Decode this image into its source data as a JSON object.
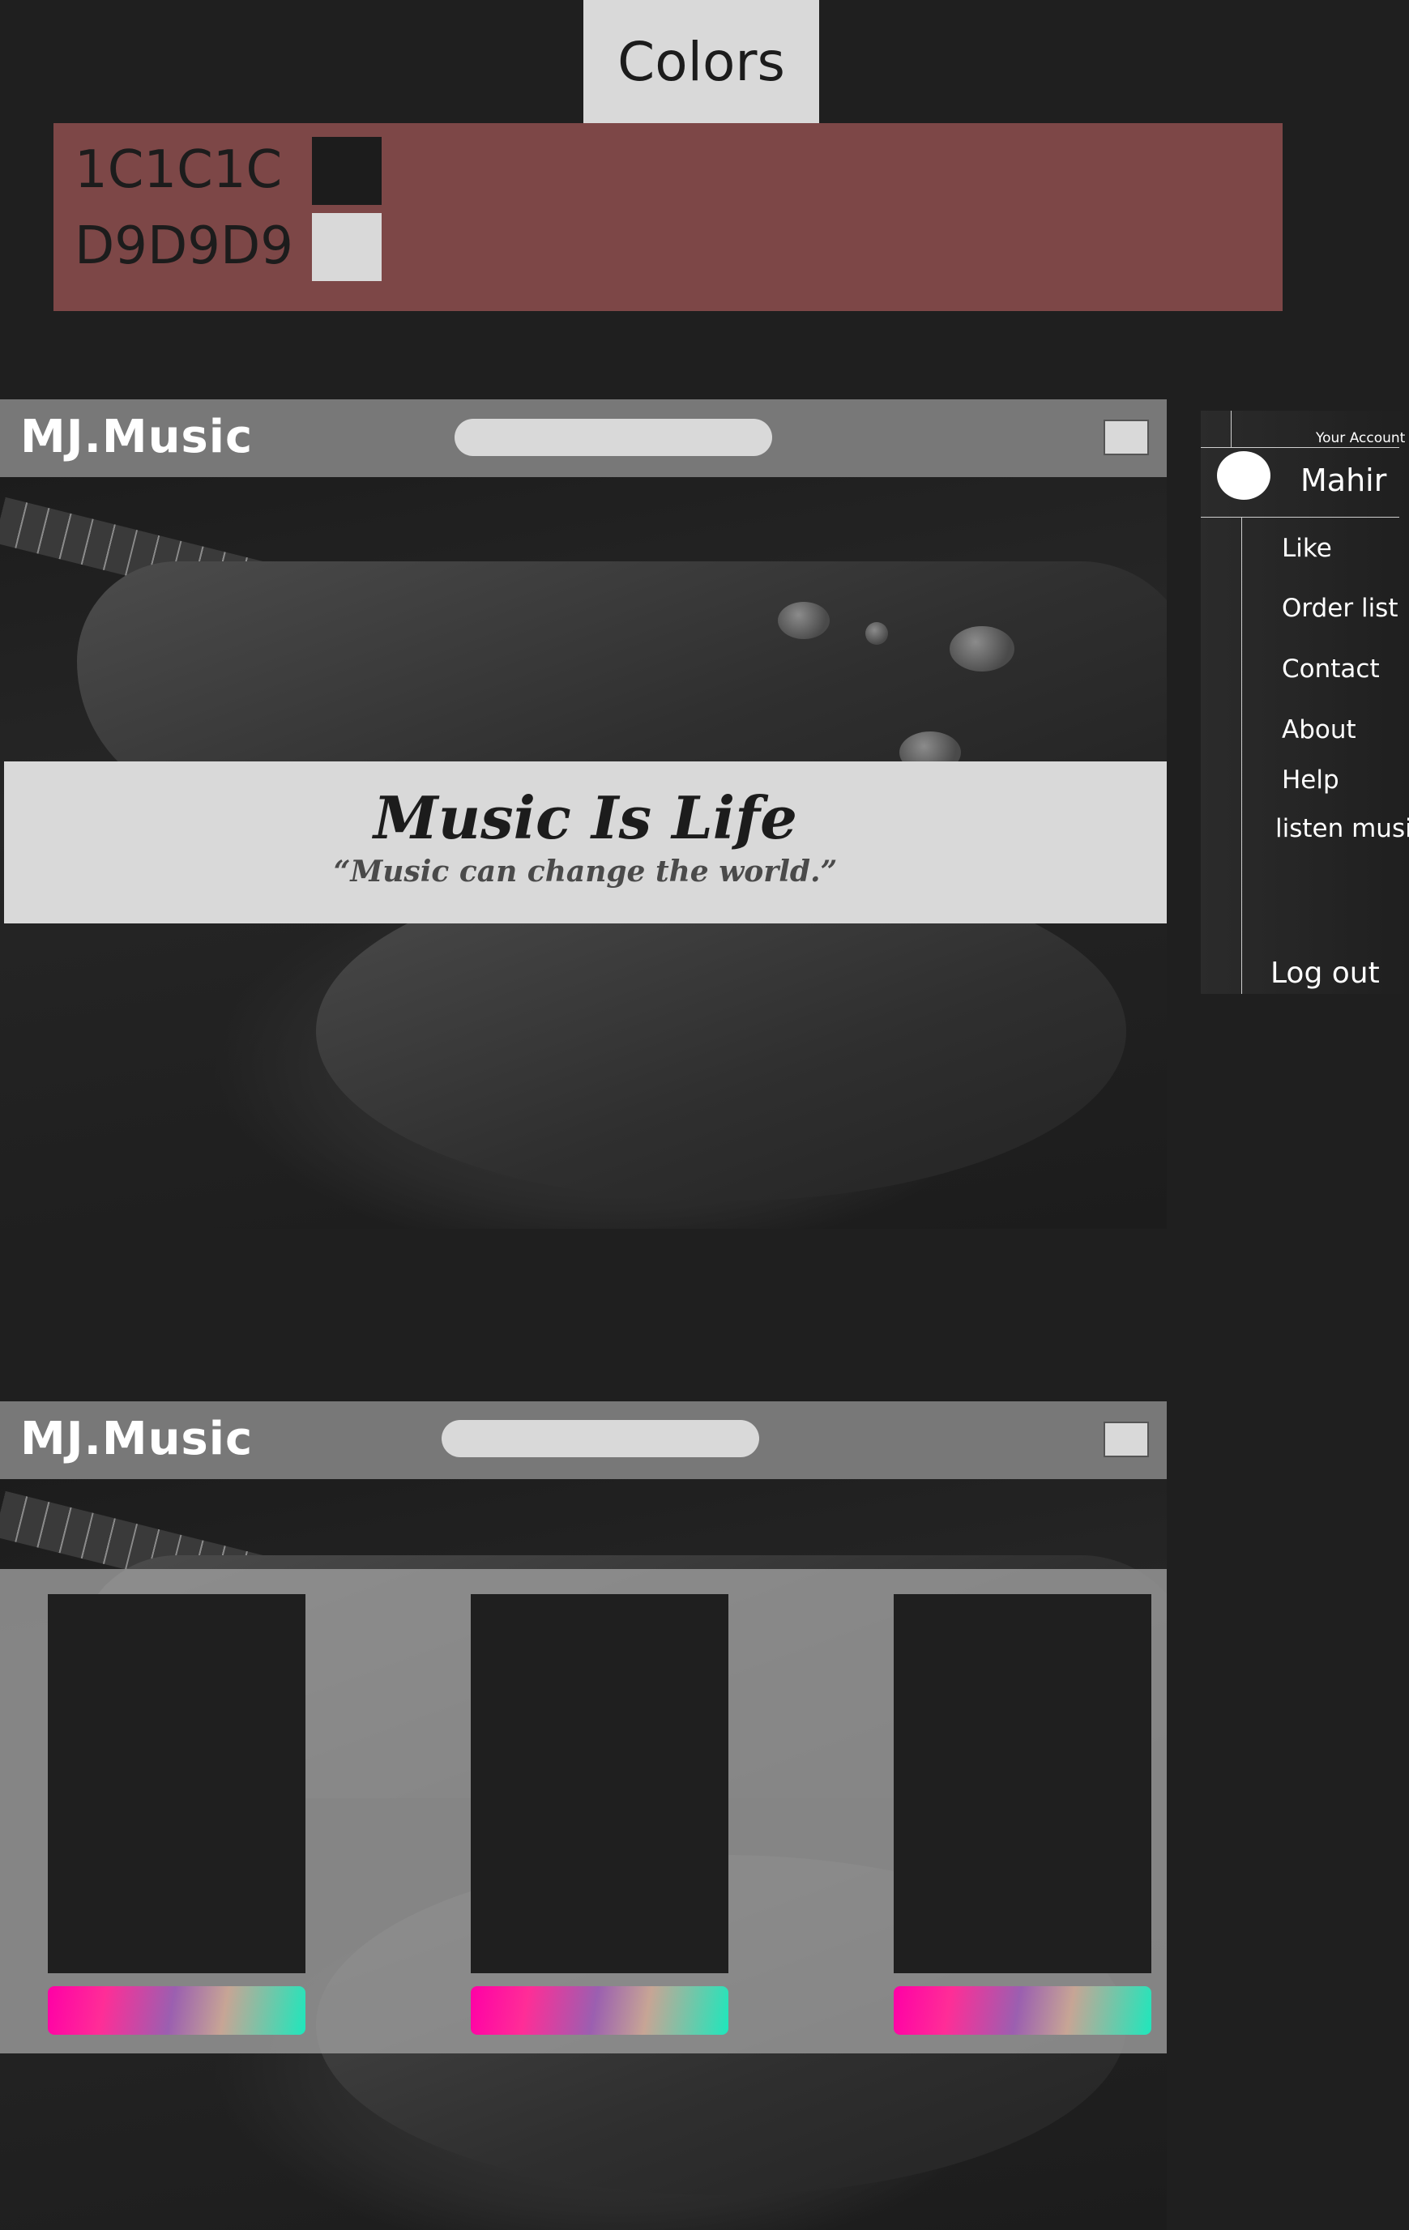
{
  "colors": {
    "title": "Colors",
    "swatches": [
      {
        "code": "1C1C1C",
        "hex": "#1C1C1C"
      },
      {
        "code": "D9D9D9",
        "hex": "#D9D9D9"
      }
    ],
    "panel_color": "#7D4747"
  },
  "home": {
    "brand": "MJ.Music",
    "hero_title": "Music Is Life",
    "hero_quote": "“Music can change the world.”"
  },
  "account": {
    "label": "Your Account",
    "name": "Mahir",
    "menu": [
      "Like",
      "Order list",
      "Contact",
      "About",
      "Help",
      "listen music"
    ],
    "logout": "Log out"
  },
  "browse": {
    "brand": "MJ.Music",
    "cards": [
      {
        "bar_gradient": [
          "#FF00A6",
          "#1EE7BC"
        ]
      },
      {
        "bar_gradient": [
          "#FF00A6",
          "#1EE7BC"
        ]
      },
      {
        "bar_gradient": [
          "#FF00A6",
          "#1EE7BC"
        ]
      }
    ]
  }
}
